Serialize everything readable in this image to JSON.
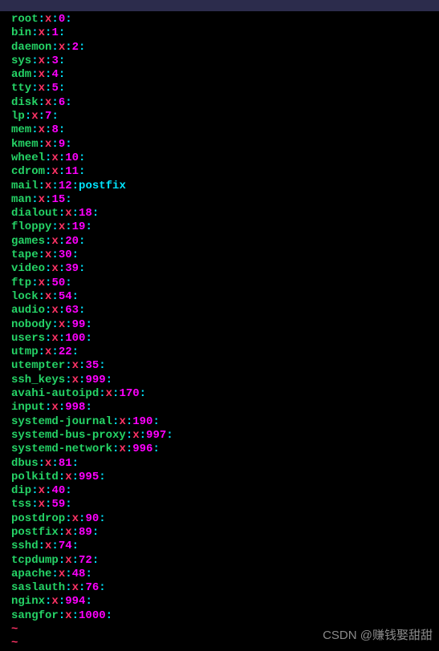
{
  "colors": {
    "bg": "#000000",
    "group": "#25d366",
    "sep": "#00e5ff",
    "x": "#ff3366",
    "gid": "#ff00ff"
  },
  "entries": [
    {
      "name": "root",
      "x": "x",
      "gid": "0",
      "members": ""
    },
    {
      "name": "bin",
      "x": "x",
      "gid": "1",
      "members": ""
    },
    {
      "name": "daemon",
      "x": "x",
      "gid": "2",
      "members": ""
    },
    {
      "name": "sys",
      "x": "x",
      "gid": "3",
      "members": ""
    },
    {
      "name": "adm",
      "x": "x",
      "gid": "4",
      "members": ""
    },
    {
      "name": "tty",
      "x": "x",
      "gid": "5",
      "members": ""
    },
    {
      "name": "disk",
      "x": "x",
      "gid": "6",
      "members": ""
    },
    {
      "name": "lp",
      "x": "x",
      "gid": "7",
      "members": ""
    },
    {
      "name": "mem",
      "x": "x",
      "gid": "8",
      "members": ""
    },
    {
      "name": "kmem",
      "x": "x",
      "gid": "9",
      "members": ""
    },
    {
      "name": "wheel",
      "x": "x",
      "gid": "10",
      "members": ""
    },
    {
      "name": "cdrom",
      "x": "x",
      "gid": "11",
      "members": ""
    },
    {
      "name": "mail",
      "x": "x",
      "gid": "12",
      "members": "postfix"
    },
    {
      "name": "man",
      "x": "x",
      "gid": "15",
      "members": ""
    },
    {
      "name": "dialout",
      "x": "x",
      "gid": "18",
      "members": ""
    },
    {
      "name": "floppy",
      "x": "x",
      "gid": "19",
      "members": ""
    },
    {
      "name": "games",
      "x": "x",
      "gid": "20",
      "members": ""
    },
    {
      "name": "tape",
      "x": "x",
      "gid": "30",
      "members": ""
    },
    {
      "name": "video",
      "x": "x",
      "gid": "39",
      "members": ""
    },
    {
      "name": "ftp",
      "x": "x",
      "gid": "50",
      "members": ""
    },
    {
      "name": "lock",
      "x": "x",
      "gid": "54",
      "members": ""
    },
    {
      "name": "audio",
      "x": "x",
      "gid": "63",
      "members": ""
    },
    {
      "name": "nobody",
      "x": "x",
      "gid": "99",
      "members": ""
    },
    {
      "name": "users",
      "x": "x",
      "gid": "100",
      "members": ""
    },
    {
      "name": "utmp",
      "x": "x",
      "gid": "22",
      "members": ""
    },
    {
      "name": "utempter",
      "x": "x",
      "gid": "35",
      "members": ""
    },
    {
      "name": "ssh_keys",
      "x": "x",
      "gid": "999",
      "members": ""
    },
    {
      "name": "avahi-autoipd",
      "x": "x",
      "gid": "170",
      "members": ""
    },
    {
      "name": "input",
      "x": "x",
      "gid": "998",
      "members": ""
    },
    {
      "name": "systemd-journal",
      "x": "x",
      "gid": "190",
      "members": ""
    },
    {
      "name": "systemd-bus-proxy",
      "x": "x",
      "gid": "997",
      "members": ""
    },
    {
      "name": "systemd-network",
      "x": "x",
      "gid": "996",
      "members": ""
    },
    {
      "name": "dbus",
      "x": "x",
      "gid": "81",
      "members": ""
    },
    {
      "name": "polkitd",
      "x": "x",
      "gid": "995",
      "members": ""
    },
    {
      "name": "dip",
      "x": "x",
      "gid": "40",
      "members": ""
    },
    {
      "name": "tss",
      "x": "x",
      "gid": "59",
      "members": ""
    },
    {
      "name": "postdrop",
      "x": "x",
      "gid": "90",
      "members": ""
    },
    {
      "name": "postfix",
      "x": "x",
      "gid": "89",
      "members": ""
    },
    {
      "name": "sshd",
      "x": "x",
      "gid": "74",
      "members": ""
    },
    {
      "name": "tcpdump",
      "x": "x",
      "gid": "72",
      "members": ""
    },
    {
      "name": "apache",
      "x": "x",
      "gid": "48",
      "members": ""
    },
    {
      "name": "saslauth",
      "x": "x",
      "gid": "76",
      "members": ""
    },
    {
      "name": "nginx",
      "x": "x",
      "gid": "994",
      "members": ""
    },
    {
      "name": "sangfor",
      "x": "x",
      "gid": "1000",
      "members": ""
    }
  ],
  "tilde": "~",
  "watermark": "CSDN @赚钱娶甜甜"
}
